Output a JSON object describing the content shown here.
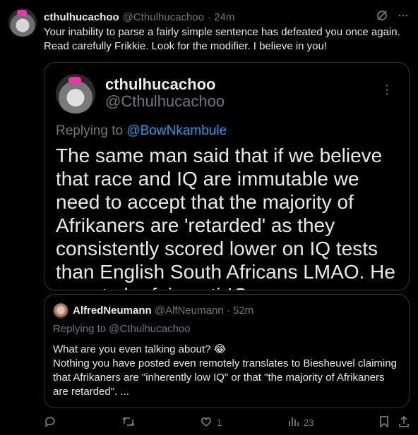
{
  "post": {
    "display_name": "cthulhucachoo",
    "handle": "@Cthulhucachoo",
    "time": "· 24m",
    "text": "Your inability to parse a fairly simple sentence has defeated you once again. Read carefully Frikkie. Look for the modifier. I believe in you!"
  },
  "quoted_post": {
    "display_name": "cthulhucachoo",
    "handle": "@Cthulhucachoo",
    "replying_prefix": "Replying to ",
    "replying_mention": "@BowNkambule",
    "text": "The same man said that if we believe that race and IQ are immutable we need to accept that the majority of Afrikaners are 'retarded' as they consistently scored lower on IQ tests than English South Africans LMAO. He was, to be fair, anti-IQ."
  },
  "nested_quote": {
    "display_name": "AlfredNeumann",
    "handle": "@AlfNeumann",
    "time": "· 52m",
    "replying": "Replying to @Cthulhucachoo",
    "line1": "What are you even talking about? 😂",
    "line2": "Nothing you have posted even remotely translates to Biesheuvel claiming that Afrikaners are \"inherently low IQ\" or that \"the majority of Afrikaners are retarded\". ..."
  },
  "actions": {
    "likes": "1",
    "views": "23"
  },
  "icons": [
    "grok-icon",
    "more-icon",
    "reply-icon",
    "repost-icon",
    "like-icon",
    "views-icon",
    "bookmark-icon",
    "share-icon"
  ],
  "colors": {
    "background": "#000000",
    "text": "#e7e9ea",
    "muted": "#71767b",
    "link": "#1d9bf0",
    "border": "#2f3336",
    "bow": "#e23aa0"
  }
}
